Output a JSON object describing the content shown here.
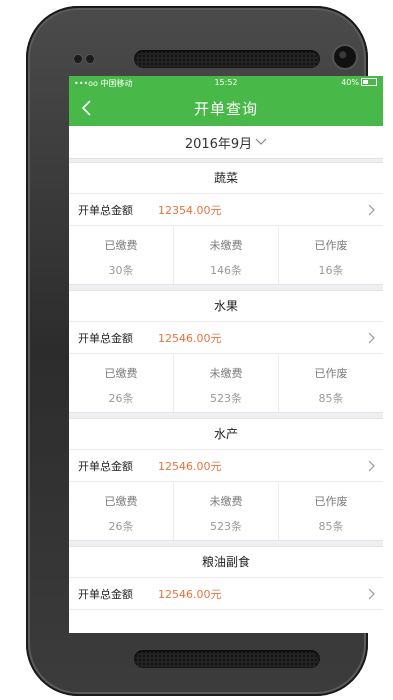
{
  "status_bar": {
    "carrier": "•••oo 中国移动",
    "time": "15:52",
    "battery": "40%"
  },
  "nav": {
    "title": "开单查询"
  },
  "month_selector": {
    "label": "2016年9月"
  },
  "amount_label": "开单总金额",
  "categories": [
    {
      "name": "蔬菜",
      "amount": "12354.00元",
      "stats": [
        {
          "label": "已缴费",
          "count": "30条"
        },
        {
          "label": "未缴费",
          "count": "146条"
        },
        {
          "label": "已作废",
          "count": "16条"
        }
      ]
    },
    {
      "name": "水果",
      "amount": "12546.00元",
      "stats": [
        {
          "label": "已缴费",
          "count": "26条"
        },
        {
          "label": "未缴费",
          "count": "523条"
        },
        {
          "label": "已作废",
          "count": "85条"
        }
      ]
    },
    {
      "name": "水产",
      "amount": "12546.00元",
      "stats": [
        {
          "label": "已缴费",
          "count": "26条"
        },
        {
          "label": "未缴费",
          "count": "523条"
        },
        {
          "label": "已作废",
          "count": "85条"
        }
      ]
    },
    {
      "name": "粮油副食",
      "amount": "12546.00元",
      "stats": []
    }
  ],
  "colors": {
    "brand_green": "#48b848",
    "amount_orange": "#e8733a"
  }
}
